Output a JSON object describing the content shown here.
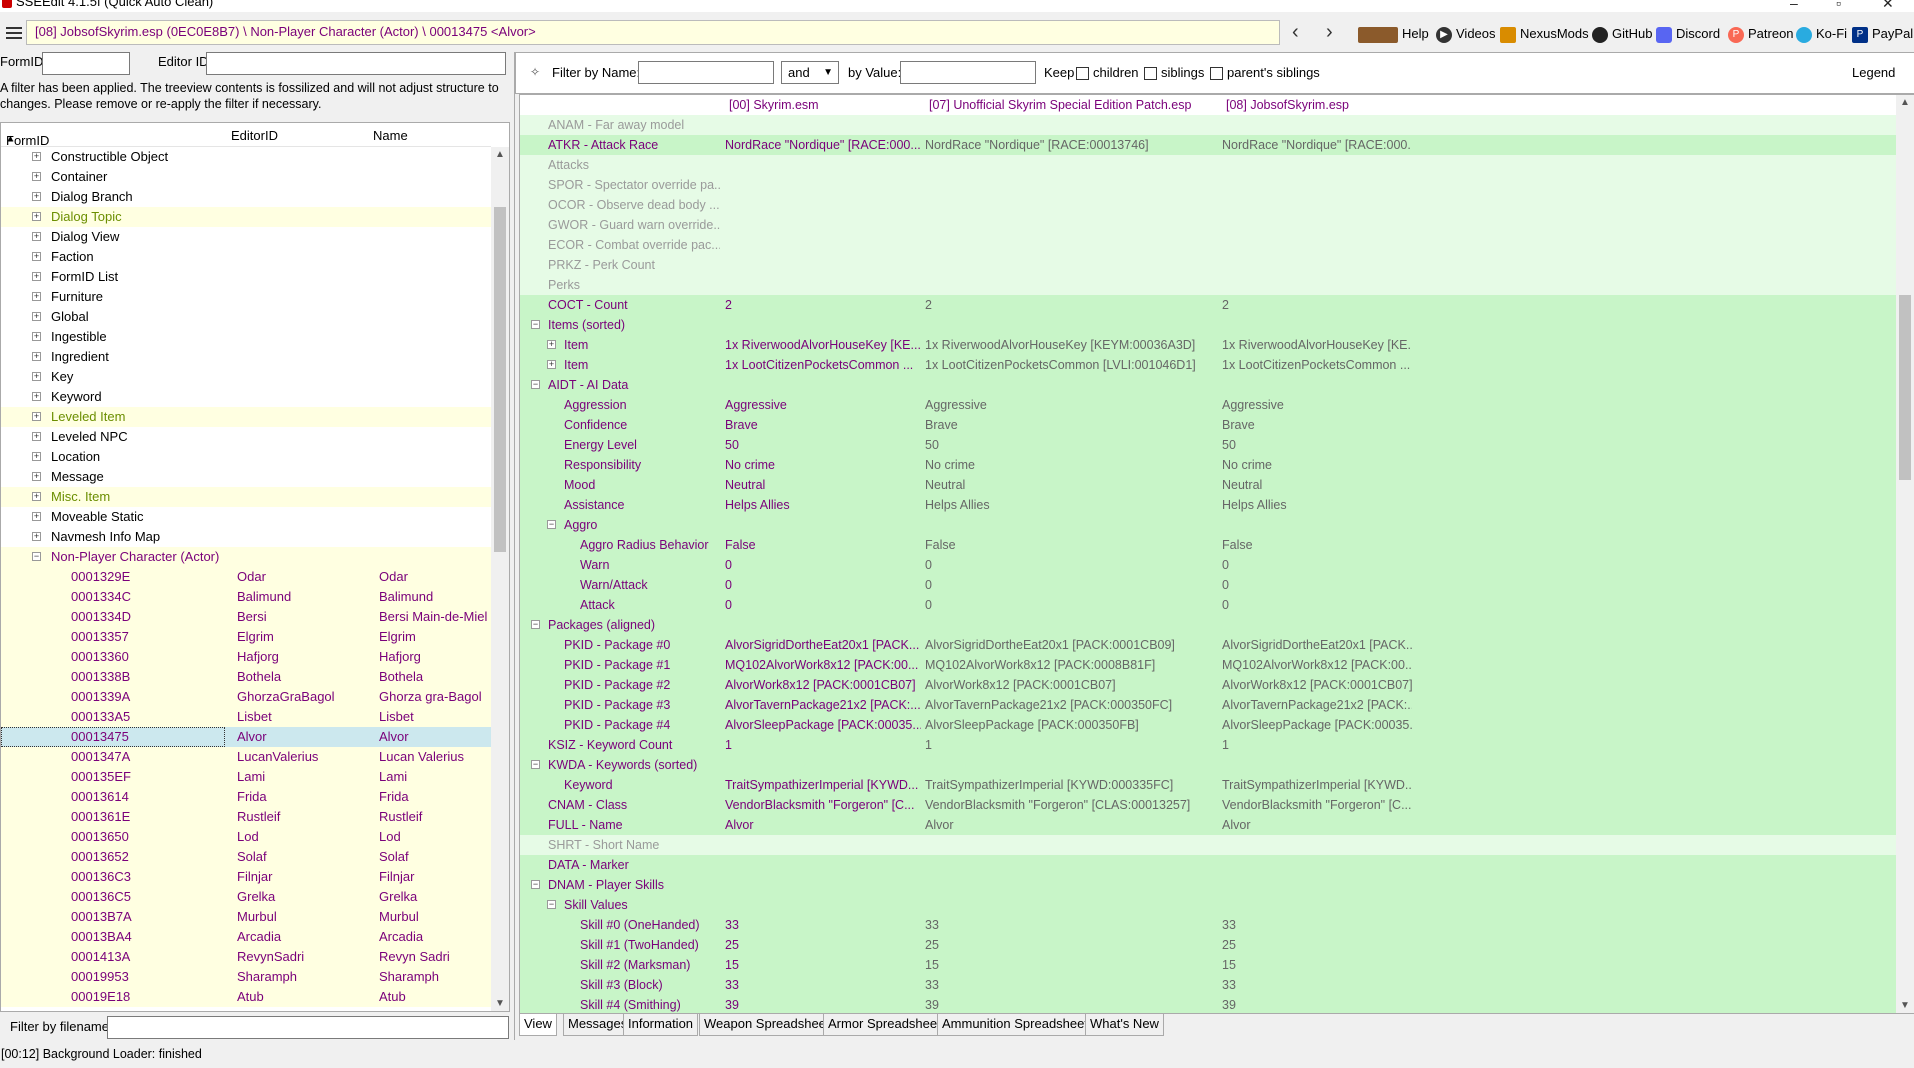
{
  "window": {
    "title": "SSEEdit 4.1.5f (Quick Auto Clean)"
  },
  "toolbar": {
    "path": "[08] JobsofSkyrim.esp (0EC0E8B7) \\ Non-Player Character (Actor) \\ 00013475 <Alvor>",
    "links": [
      "Help",
      "Videos",
      "NexusMods",
      "GitHub",
      "Discord",
      "Patreon",
      "Ko-Fi",
      "PayPal"
    ]
  },
  "left": {
    "formid_label": "FormID",
    "editorid_label": "Editor ID",
    "filter_message": "A filter has been applied. The treeview contents is fossilized and will not adjust structure to changes.  Please remove or re-apply the filter if necessary.",
    "columns": [
      "FormID",
      "EditorID",
      "Name"
    ],
    "groups": [
      {
        "label": "Constructible Object",
        "hl": false
      },
      {
        "label": "Container",
        "hl": false
      },
      {
        "label": "Dialog Branch",
        "hl": false
      },
      {
        "label": "Dialog Topic",
        "hl": true
      },
      {
        "label": "Dialog View",
        "hl": false
      },
      {
        "label": "Faction",
        "hl": false
      },
      {
        "label": "FormID List",
        "hl": false
      },
      {
        "label": "Furniture",
        "hl": false
      },
      {
        "label": "Global",
        "hl": false
      },
      {
        "label": "Ingestible",
        "hl": false
      },
      {
        "label": "Ingredient",
        "hl": false
      },
      {
        "label": "Key",
        "hl": false
      },
      {
        "label": "Keyword",
        "hl": false
      },
      {
        "label": "Leveled Item",
        "hl": true
      },
      {
        "label": "Leveled NPC",
        "hl": false
      },
      {
        "label": "Location",
        "hl": false
      },
      {
        "label": "Message",
        "hl": false
      },
      {
        "label": "Misc. Item",
        "hl": true
      },
      {
        "label": "Moveable Static",
        "hl": false
      },
      {
        "label": "Navmesh Info Map",
        "hl": false
      },
      {
        "label": "Non-Player Character (Actor)",
        "hl": true
      }
    ],
    "npcs": [
      {
        "formid": "0001329E",
        "editorid": "Odar",
        "name": "Odar"
      },
      {
        "formid": "0001334C",
        "editorid": "Balimund",
        "name": "Balimund"
      },
      {
        "formid": "0001334D",
        "editorid": "Bersi",
        "name": "Bersi Main-de-Miel"
      },
      {
        "formid": "00013357",
        "editorid": "Elgrim",
        "name": "Elgrim"
      },
      {
        "formid": "00013360",
        "editorid": "Hafjorg",
        "name": "Hafjorg"
      },
      {
        "formid": "0001338B",
        "editorid": "Bothela",
        "name": "Bothela"
      },
      {
        "formid": "0001339A",
        "editorid": "GhorzaGraBagol",
        "name": "Ghorza gra-Bagol"
      },
      {
        "formid": "000133A5",
        "editorid": "Lisbet",
        "name": "Lisbet"
      },
      {
        "formid": "00013475",
        "editorid": "Alvor",
        "name": "Alvor"
      },
      {
        "formid": "0001347A",
        "editorid": "LucanValerius",
        "name": "Lucan Valerius"
      },
      {
        "formid": "000135EF",
        "editorid": "Lami",
        "name": "Lami"
      },
      {
        "formid": "00013614",
        "editorid": "Frida",
        "name": "Frida"
      },
      {
        "formid": "0001361E",
        "editorid": "Rustleif",
        "name": "Rustleif"
      },
      {
        "formid": "00013650",
        "editorid": "Lod",
        "name": "Lod"
      },
      {
        "formid": "00013652",
        "editorid": "Solaf",
        "name": "Solaf"
      },
      {
        "formid": "000136C3",
        "editorid": "Filnjar",
        "name": "Filnjar"
      },
      {
        "formid": "000136C5",
        "editorid": "Grelka",
        "name": "Grelka"
      },
      {
        "formid": "00013B7A",
        "editorid": "Murbul",
        "name": "Murbul"
      },
      {
        "formid": "00013BA4",
        "editorid": "Arcadia",
        "name": "Arcadia"
      },
      {
        "formid": "0001413A",
        "editorid": "RevynSadri",
        "name": "Revyn Sadri"
      },
      {
        "formid": "00019953",
        "editorid": "Sharamph",
        "name": "Sharamph"
      },
      {
        "formid": "00019E18",
        "editorid": "Atub",
        "name": "Atub"
      }
    ],
    "filename_label": "Filter by filename:"
  },
  "right": {
    "filter_name_label": "Filter by Name:",
    "op": "and",
    "by_value_label": "by Value:",
    "keep_label": "Keep",
    "children_label": "children",
    "siblings_label": "siblings",
    "parents_siblings_label": "parent's siblings",
    "legend_label": "Legend",
    "files": [
      "[00] Skyrim.esm",
      "[07] Unofficial Skyrim Special Edition Patch.esp",
      "[08] JobsofSkyrim.esp"
    ],
    "rows": [
      {
        "label": "ANAM - Far away model",
        "indent": 0,
        "dim": true,
        "v": [
          "",
          "",
          ""
        ]
      },
      {
        "label": "ATKR - Attack Race",
        "indent": 0,
        "v": [
          "NordRace \"Nordique\" [RACE:000...",
          "NordRace \"Nordique\" [RACE:00013746]",
          "NordRace \"Nordique\" [RACE:000..."
        ]
      },
      {
        "label": "Attacks",
        "indent": 0,
        "dim": true,
        "v": [
          "",
          "",
          ""
        ]
      },
      {
        "label": "SPOR - Spectator override pa...",
        "indent": 0,
        "dim": true,
        "v": [
          "",
          "",
          ""
        ]
      },
      {
        "label": "OCOR - Observe dead body ...",
        "indent": 0,
        "dim": true,
        "v": [
          "",
          "",
          ""
        ]
      },
      {
        "label": "GWOR - Guard warn override...",
        "indent": 0,
        "dim": true,
        "v": [
          "",
          "",
          ""
        ]
      },
      {
        "label": "ECOR - Combat override pac...",
        "indent": 0,
        "dim": true,
        "v": [
          "",
          "",
          ""
        ]
      },
      {
        "label": "PRKZ - Perk Count",
        "indent": 0,
        "dim": true,
        "v": [
          "",
          "",
          ""
        ]
      },
      {
        "label": "Perks",
        "indent": 0,
        "dim": true,
        "v": [
          "",
          "",
          ""
        ]
      },
      {
        "label": "COCT - Count",
        "indent": 0,
        "v": [
          "2",
          "2",
          "2"
        ]
      },
      {
        "label": "Items (sorted)",
        "indent": 0,
        "exp": "minus",
        "v": [
          "",
          "",
          ""
        ]
      },
      {
        "label": "Item",
        "indent": 1,
        "exp": "plus",
        "v": [
          "1x RiverwoodAlvorHouseKey [KE...",
          "1x RiverwoodAlvorHouseKey [KEYM:00036A3D]",
          "1x RiverwoodAlvorHouseKey [KE..."
        ]
      },
      {
        "label": "Item",
        "indent": 1,
        "exp": "plus",
        "v": [
          "1x LootCitizenPocketsCommon ...",
          "1x LootCitizenPocketsCommon [LVLI:001046D1]",
          "1x LootCitizenPocketsCommon ..."
        ]
      },
      {
        "label": "AIDT - AI Data",
        "indent": 0,
        "exp": "minus",
        "v": [
          "",
          "",
          ""
        ]
      },
      {
        "label": "Aggression",
        "indent": 1,
        "v": [
          "Aggressive",
          "Aggressive",
          "Aggressive"
        ]
      },
      {
        "label": "Confidence",
        "indent": 1,
        "v": [
          "Brave",
          "Brave",
          "Brave"
        ]
      },
      {
        "label": "Energy Level",
        "indent": 1,
        "v": [
          "50",
          "50",
          "50"
        ]
      },
      {
        "label": "Responsibility",
        "indent": 1,
        "v": [
          "No crime",
          "No crime",
          "No crime"
        ]
      },
      {
        "label": "Mood",
        "indent": 1,
        "v": [
          "Neutral",
          "Neutral",
          "Neutral"
        ]
      },
      {
        "label": "Assistance",
        "indent": 1,
        "v": [
          "Helps Allies",
          "Helps Allies",
          "Helps Allies"
        ]
      },
      {
        "label": "Aggro",
        "indent": 1,
        "exp": "minus",
        "v": [
          "",
          "",
          ""
        ]
      },
      {
        "label": "Aggro Radius Behavior",
        "indent": 2,
        "v": [
          "False",
          "False",
          "False"
        ]
      },
      {
        "label": "Warn",
        "indent": 2,
        "v": [
          "0",
          "0",
          "0"
        ]
      },
      {
        "label": "Warn/Attack",
        "indent": 2,
        "v": [
          "0",
          "0",
          "0"
        ]
      },
      {
        "label": "Attack",
        "indent": 2,
        "v": [
          "0",
          "0",
          "0"
        ]
      },
      {
        "label": "Packages (aligned)",
        "indent": 0,
        "exp": "minus",
        "v": [
          "",
          "",
          ""
        ]
      },
      {
        "label": "PKID - Package #0",
        "indent": 1,
        "v": [
          "AlvorSigridDortheEat20x1 [PACK...",
          "AlvorSigridDortheEat20x1 [PACK:0001CB09]",
          "AlvorSigridDortheEat20x1 [PACK..."
        ]
      },
      {
        "label": "PKID - Package #1",
        "indent": 1,
        "v": [
          "MQ102AlvorWork8x12 [PACK:00...",
          "MQ102AlvorWork8x12 [PACK:0008B81F]",
          "MQ102AlvorWork8x12 [PACK:00..."
        ]
      },
      {
        "label": "PKID - Package #2",
        "indent": 1,
        "v": [
          "AlvorWork8x12 [PACK:0001CB07]",
          "AlvorWork8x12 [PACK:0001CB07]",
          "AlvorWork8x12 [PACK:0001CB07]"
        ]
      },
      {
        "label": "PKID - Package #3",
        "indent": 1,
        "v": [
          "AlvorTavernPackage21x2 [PACK:...",
          "AlvorTavernPackage21x2 [PACK:000350FC]",
          "AlvorTavernPackage21x2 [PACK:..."
        ]
      },
      {
        "label": "PKID - Package #4",
        "indent": 1,
        "v": [
          "AlvorSleepPackage [PACK:00035...",
          "AlvorSleepPackage [PACK:000350FB]",
          "AlvorSleepPackage [PACK:00035..."
        ]
      },
      {
        "label": "KSIZ - Keyword Count",
        "indent": 0,
        "v": [
          "1",
          "1",
          "1"
        ]
      },
      {
        "label": "KWDA - Keywords (sorted)",
        "indent": 0,
        "exp": "minus",
        "v": [
          "",
          "",
          ""
        ]
      },
      {
        "label": "Keyword",
        "indent": 1,
        "v": [
          "TraitSympathizerImperial [KYWD...",
          "TraitSympathizerImperial [KYWD:000335FC]",
          "TraitSympathizerImperial [KYWD..."
        ]
      },
      {
        "label": "CNAM - Class",
        "indent": 0,
        "v": [
          "VendorBlacksmith \"Forgeron\" [C...",
          "VendorBlacksmith \"Forgeron\" [CLAS:00013257]",
          "VendorBlacksmith \"Forgeron\" [C..."
        ]
      },
      {
        "label": "FULL - Name",
        "indent": 0,
        "v": [
          "Alvor",
          "Alvor",
          "Alvor"
        ]
      },
      {
        "label": "SHRT - Short Name",
        "indent": 0,
        "dim": true,
        "v": [
          "",
          "",
          ""
        ]
      },
      {
        "label": "DATA - Marker",
        "indent": 0,
        "v": [
          "",
          "",
          ""
        ]
      },
      {
        "label": "DNAM - Player Skills",
        "indent": 0,
        "exp": "minus",
        "v": [
          "",
          "",
          ""
        ]
      },
      {
        "label": "Skill Values",
        "indent": 1,
        "exp": "minus",
        "v": [
          "",
          "",
          ""
        ]
      },
      {
        "label": "Skill #0 (OneHanded)",
        "indent": 2,
        "v": [
          "33",
          "33",
          "33"
        ]
      },
      {
        "label": "Skill #1 (TwoHanded)",
        "indent": 2,
        "v": [
          "25",
          "25",
          "25"
        ]
      },
      {
        "label": "Skill #2 (Marksman)",
        "indent": 2,
        "v": [
          "15",
          "15",
          "15"
        ]
      },
      {
        "label": "Skill #3 (Block)",
        "indent": 2,
        "v": [
          "33",
          "33",
          "33"
        ]
      },
      {
        "label": "Skill #4 (Smithing)",
        "indent": 2,
        "v": [
          "39",
          "39",
          "39"
        ]
      }
    ],
    "tabs": [
      "View",
      "Messages",
      "Information",
      "Weapon Spreadsheet",
      "Armor Spreadsheet",
      "Ammunition Spreadsheet",
      "What's New"
    ]
  },
  "status": {
    "text": "[00:12] Background Loader: finished"
  }
}
